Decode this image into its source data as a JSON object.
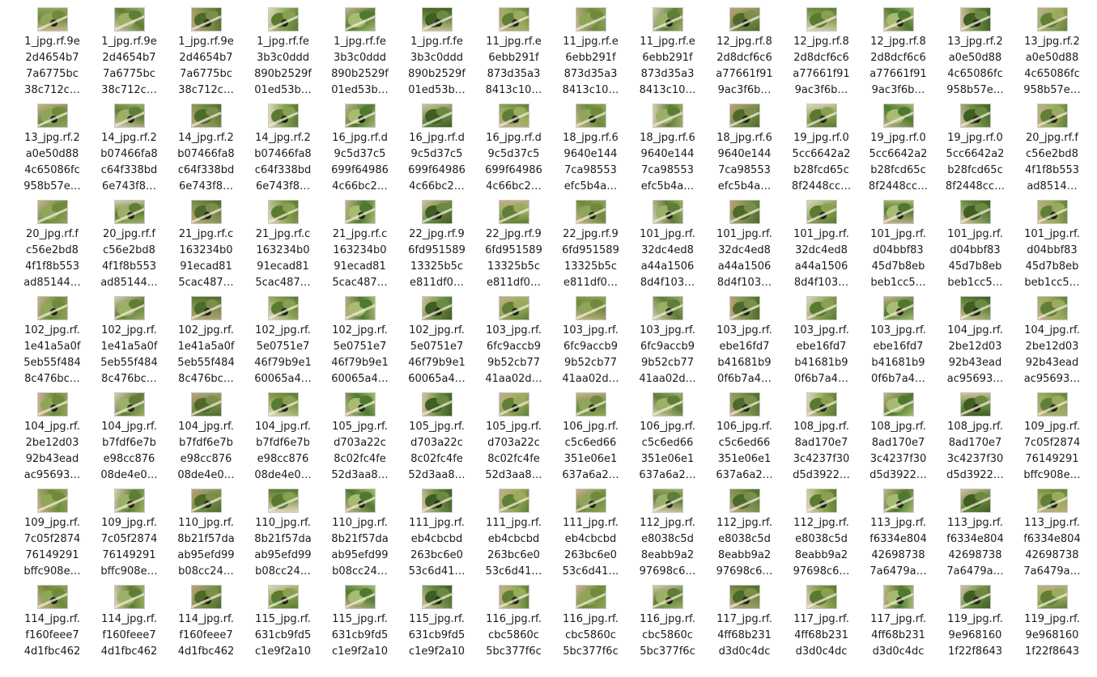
{
  "files": [
    {
      "l1": "1_jpg.rf.9e",
      "l2": "2d4654b7",
      "l3": "7a6775bc",
      "l4": "38c712c…",
      "icon": "image-thumbnail"
    },
    {
      "l1": "1_jpg.rf.9e",
      "l2": "2d4654b7",
      "l3": "7a6775bc",
      "l4": "38c712c…",
      "icon": "image-thumbnail"
    },
    {
      "l1": "1_jpg.rf.9e",
      "l2": "2d4654b7",
      "l3": "7a6775bc",
      "l4": "38c712c…",
      "icon": "image-thumbnail"
    },
    {
      "l1": "1_jpg.rf.fe",
      "l2": "3b3c0ddd",
      "l3": "890b2529f",
      "l4": "01ed53b…",
      "icon": "image-thumbnail"
    },
    {
      "l1": "1_jpg.rf.fe",
      "l2": "3b3c0ddd",
      "l3": "890b2529f",
      "l4": "01ed53b…",
      "icon": "image-thumbnail"
    },
    {
      "l1": "1_jpg.rf.fe",
      "l2": "3b3c0ddd",
      "l3": "890b2529f",
      "l4": "01ed53b…",
      "icon": "image-thumbnail"
    },
    {
      "l1": "11_jpg.rf.e",
      "l2": "6ebb291f",
      "l3": "873d35a3",
      "l4": "8413c10…",
      "icon": "image-thumbnail"
    },
    {
      "l1": "11_jpg.rf.e",
      "l2": "6ebb291f",
      "l3": "873d35a3",
      "l4": "8413c10…",
      "icon": "image-thumbnail"
    },
    {
      "l1": "11_jpg.rf.e",
      "l2": "6ebb291f",
      "l3": "873d35a3",
      "l4": "8413c10…",
      "icon": "image-thumbnail"
    },
    {
      "l1": "12_jpg.rf.8",
      "l2": "2d8dcf6c6",
      "l3": "a77661f91",
      "l4": "9ac3f6b…",
      "icon": "image-thumbnail"
    },
    {
      "l1": "12_jpg.rf.8",
      "l2": "2d8dcf6c6",
      "l3": "a77661f91",
      "l4": "9ac3f6b…",
      "icon": "image-thumbnail"
    },
    {
      "l1": "12_jpg.rf.8",
      "l2": "2d8dcf6c6",
      "l3": "a77661f91",
      "l4": "9ac3f6b…",
      "icon": "image-thumbnail"
    },
    {
      "l1": "13_jpg.rf.2",
      "l2": "a0e50d88",
      "l3": "4c65086fc",
      "l4": "958b57e…",
      "icon": "image-thumbnail"
    },
    {
      "l1": "13_jpg.rf.2",
      "l2": "a0e50d88",
      "l3": "4c65086fc",
      "l4": "958b57e…",
      "icon": "image-thumbnail"
    },
    {
      "l1": "13_jpg.rf.2",
      "l2": "a0e50d88",
      "l3": "4c65086fc",
      "l4": "958b57e…",
      "icon": "image-thumbnail"
    },
    {
      "l1": "14_jpg.rf.2",
      "l2": "b07466fa8",
      "l3": "c64f338bd",
      "l4": "6e743f8…",
      "icon": "image-thumbnail"
    },
    {
      "l1": "14_jpg.rf.2",
      "l2": "b07466fa8",
      "l3": "c64f338bd",
      "l4": "6e743f8…",
      "icon": "image-thumbnail"
    },
    {
      "l1": "14_jpg.rf.2",
      "l2": "b07466fa8",
      "l3": "c64f338bd",
      "l4": "6e743f8…",
      "icon": "image-thumbnail"
    },
    {
      "l1": "16_jpg.rf.d",
      "l2": "9c5d37c5",
      "l3": "699f64986",
      "l4": "4c66bc2…",
      "icon": "image-thumbnail"
    },
    {
      "l1": "16_jpg.rf.d",
      "l2": "9c5d37c5",
      "l3": "699f64986",
      "l4": "4c66bc2…",
      "icon": "image-thumbnail"
    },
    {
      "l1": "16_jpg.rf.d",
      "l2": "9c5d37c5",
      "l3": "699f64986",
      "l4": "4c66bc2…",
      "icon": "image-thumbnail"
    },
    {
      "l1": "18_jpg.rf.6",
      "l2": "9640e144",
      "l3": "7ca98553",
      "l4": "efc5b4a…",
      "icon": "image-thumbnail"
    },
    {
      "l1": "18_jpg.rf.6",
      "l2": "9640e144",
      "l3": "7ca98553",
      "l4": "efc5b4a…",
      "icon": "image-thumbnail"
    },
    {
      "l1": "18_jpg.rf.6",
      "l2": "9640e144",
      "l3": "7ca98553",
      "l4": "efc5b4a…",
      "icon": "image-thumbnail"
    },
    {
      "l1": "19_jpg.rf.0",
      "l2": "5cc6642a2",
      "l3": "b28fcd65c",
      "l4": "8f2448cc…",
      "icon": "image-thumbnail"
    },
    {
      "l1": "19_jpg.rf.0",
      "l2": "5cc6642a2",
      "l3": "b28fcd65c",
      "l4": "8f2448cc…",
      "icon": "image-thumbnail"
    },
    {
      "l1": "19_jpg.rf.0",
      "l2": "5cc6642a2",
      "l3": "b28fcd65c",
      "l4": "8f2448cc…",
      "icon": "image-thumbnail"
    },
    {
      "l1": "20_jpg.rf.f",
      "l2": "c56e2bd8",
      "l3": "4f1f8b553",
      "l4": "ad8514…",
      "icon": "image-thumbnail"
    },
    {
      "l1": "20_jpg.rf.f",
      "l2": "c56e2bd8",
      "l3": "4f1f8b553",
      "l4": "ad85144…",
      "icon": "image-thumbnail"
    },
    {
      "l1": "20_jpg.rf.f",
      "l2": "c56e2bd8",
      "l3": "4f1f8b553",
      "l4": "ad85144…",
      "icon": "image-thumbnail"
    },
    {
      "l1": "21_jpg.rf.c",
      "l2": "163234b0",
      "l3": "91ecad81",
      "l4": "5cac487…",
      "icon": "image-thumbnail"
    },
    {
      "l1": "21_jpg.rf.c",
      "l2": "163234b0",
      "l3": "91ecad81",
      "l4": "5cac487…",
      "icon": "image-thumbnail"
    },
    {
      "l1": "21_jpg.rf.c",
      "l2": "163234b0",
      "l3": "91ecad81",
      "l4": "5cac487…",
      "icon": "image-thumbnail"
    },
    {
      "l1": "22_jpg.rf.9",
      "l2": "6fd951589",
      "l3": "13325b5c",
      "l4": "e811df0…",
      "icon": "image-thumbnail"
    },
    {
      "l1": "22_jpg.rf.9",
      "l2": "6fd951589",
      "l3": "13325b5c",
      "l4": "e811df0…",
      "icon": "image-thumbnail"
    },
    {
      "l1": "22_jpg.rf.9",
      "l2": "6fd951589",
      "l3": "13325b5c",
      "l4": "e811df0…",
      "icon": "image-thumbnail"
    },
    {
      "l1": "101_jpg.rf.",
      "l2": "32dc4ed8",
      "l3": "a44a1506",
      "l4": "8d4f103…",
      "icon": "image-thumbnail"
    },
    {
      "l1": "101_jpg.rf.",
      "l2": "32dc4ed8",
      "l3": "a44a1506",
      "l4": "8d4f103…",
      "icon": "image-thumbnail"
    },
    {
      "l1": "101_jpg.rf.",
      "l2": "32dc4ed8",
      "l3": "a44a1506",
      "l4": "8d4f103…",
      "icon": "image-thumbnail"
    },
    {
      "l1": "101_jpg.rf.",
      "l2": "d04bbf83",
      "l3": "45d7b8eb",
      "l4": "beb1cc5…",
      "icon": "image-thumbnail"
    },
    {
      "l1": "101_jpg.rf.",
      "l2": "d04bbf83",
      "l3": "45d7b8eb",
      "l4": "beb1cc5…",
      "icon": "image-thumbnail"
    },
    {
      "l1": "101_jpg.rf.",
      "l2": "d04bbf83",
      "l3": "45d7b8eb",
      "l4": "beb1cc5…",
      "icon": "image-thumbnail"
    },
    {
      "l1": "102_jpg.rf.",
      "l2": "1e41a5a0f",
      "l3": "5eb55f484",
      "l4": "8c476bc…",
      "icon": "image-thumbnail"
    },
    {
      "l1": "102_jpg.rf.",
      "l2": "1e41a5a0f",
      "l3": "5eb55f484",
      "l4": "8c476bc…",
      "icon": "image-thumbnail"
    },
    {
      "l1": "102_jpg.rf.",
      "l2": "1e41a5a0f",
      "l3": "5eb55f484",
      "l4": "8c476bc…",
      "icon": "image-thumbnail"
    },
    {
      "l1": "102_jpg.rf.",
      "l2": "5e0751e7",
      "l3": "46f79b9e1",
      "l4": "60065a4…",
      "icon": "image-thumbnail"
    },
    {
      "l1": "102_jpg.rf.",
      "l2": "5e0751e7",
      "l3": "46f79b9e1",
      "l4": "60065a4…",
      "icon": "image-thumbnail"
    },
    {
      "l1": "102_jpg.rf.",
      "l2": "5e0751e7",
      "l3": "46f79b9e1",
      "l4": "60065a4…",
      "icon": "image-thumbnail"
    },
    {
      "l1": "103_jpg.rf.",
      "l2": "6fc9accb9",
      "l3": "9b52cb77",
      "l4": "41aa02d…",
      "icon": "image-thumbnail"
    },
    {
      "l1": "103_jpg.rf.",
      "l2": "6fc9accb9",
      "l3": "9b52cb77",
      "l4": "41aa02d…",
      "icon": "image-thumbnail"
    },
    {
      "l1": "103_jpg.rf.",
      "l2": "6fc9accb9",
      "l3": "9b52cb77",
      "l4": "41aa02d…",
      "icon": "image-thumbnail"
    },
    {
      "l1": "103_jpg.rf.",
      "l2": "ebe16fd7",
      "l3": "b41681b9",
      "l4": "0f6b7a4…",
      "icon": "image-thumbnail"
    },
    {
      "l1": "103_jpg.rf.",
      "l2": "ebe16fd7",
      "l3": "b41681b9",
      "l4": "0f6b7a4…",
      "icon": "image-thumbnail"
    },
    {
      "l1": "103_jpg.rf.",
      "l2": "ebe16fd7",
      "l3": "b41681b9",
      "l4": "0f6b7a4…",
      "icon": "image-thumbnail"
    },
    {
      "l1": "104_jpg.rf.",
      "l2": "2be12d03",
      "l3": "92b43ead",
      "l4": "ac95693…",
      "icon": "image-thumbnail"
    },
    {
      "l1": "104_jpg.rf.",
      "l2": "2be12d03",
      "l3": "92b43ead",
      "l4": "ac95693…",
      "icon": "image-thumbnail"
    },
    {
      "l1": "104_jpg.rf.",
      "l2": "2be12d03",
      "l3": "92b43ead",
      "l4": "ac95693…",
      "icon": "image-thumbnail"
    },
    {
      "l1": "104_jpg.rf.",
      "l2": "b7fdf6e7b",
      "l3": "e98cc876",
      "l4": "08de4e0…",
      "icon": "image-thumbnail"
    },
    {
      "l1": "104_jpg.rf.",
      "l2": "b7fdf6e7b",
      "l3": "e98cc876",
      "l4": "08de4e0…",
      "icon": "image-thumbnail"
    },
    {
      "l1": "104_jpg.rf.",
      "l2": "b7fdf6e7b",
      "l3": "e98cc876",
      "l4": "08de4e0…",
      "icon": "image-thumbnail"
    },
    {
      "l1": "105_jpg.rf.",
      "l2": "d703a22c",
      "l3": "8c02fc4fe",
      "l4": "52d3aa8…",
      "icon": "image-thumbnail"
    },
    {
      "l1": "105_jpg.rf.",
      "l2": "d703a22c",
      "l3": "8c02fc4fe",
      "l4": "52d3aa8…",
      "icon": "image-thumbnail"
    },
    {
      "l1": "105_jpg.rf.",
      "l2": "d703a22c",
      "l3": "8c02fc4fe",
      "l4": "52d3aa8…",
      "icon": "image-thumbnail"
    },
    {
      "l1": "106_jpg.rf.",
      "l2": "c5c6ed66",
      "l3": "351e06e1",
      "l4": "637a6a2…",
      "icon": "image-thumbnail"
    },
    {
      "l1": "106_jpg.rf.",
      "l2": "c5c6ed66",
      "l3": "351e06e1",
      "l4": "637a6a2…",
      "icon": "image-thumbnail"
    },
    {
      "l1": "106_jpg.rf.",
      "l2": "c5c6ed66",
      "l3": "351e06e1",
      "l4": "637a6a2…",
      "icon": "image-thumbnail"
    },
    {
      "l1": "108_jpg.rf.",
      "l2": "8ad170e7",
      "l3": "3c4237f30",
      "l4": "d5d3922…",
      "icon": "image-thumbnail"
    },
    {
      "l1": "108_jpg.rf.",
      "l2": "8ad170e7",
      "l3": "3c4237f30",
      "l4": "d5d3922…",
      "icon": "image-thumbnail"
    },
    {
      "l1": "108_jpg.rf.",
      "l2": "8ad170e7",
      "l3": "3c4237f30",
      "l4": "d5d3922…",
      "icon": "image-thumbnail"
    },
    {
      "l1": "109_jpg.rf.",
      "l2": "7c05f2874",
      "l3": "76149291",
      "l4": "bffc908e…",
      "icon": "image-thumbnail"
    },
    {
      "l1": "109_jpg.rf.",
      "l2": "7c05f2874",
      "l3": "76149291",
      "l4": "bffc908e…",
      "icon": "image-thumbnail"
    },
    {
      "l1": "109_jpg.rf.",
      "l2": "7c05f2874",
      "l3": "76149291",
      "l4": "bffc908e…",
      "icon": "image-thumbnail"
    },
    {
      "l1": "110_jpg.rf.",
      "l2": "8b21f57da",
      "l3": "ab95efd99",
      "l4": "b08cc24…",
      "icon": "image-thumbnail"
    },
    {
      "l1": "110_jpg.rf.",
      "l2": "8b21f57da",
      "l3": "ab95efd99",
      "l4": "b08cc24…",
      "icon": "image-thumbnail"
    },
    {
      "l1": "110_jpg.rf.",
      "l2": "8b21f57da",
      "l3": "ab95efd99",
      "l4": "b08cc24…",
      "icon": "image-thumbnail"
    },
    {
      "l1": "111_jpg.rf.",
      "l2": "eb4cbcbd",
      "l3": "263bc6e0",
      "l4": "53c6d41…",
      "icon": "image-thumbnail"
    },
    {
      "l1": "111_jpg.rf.",
      "l2": "eb4cbcbd",
      "l3": "263bc6e0",
      "l4": "53c6d41…",
      "icon": "image-thumbnail"
    },
    {
      "l1": "111_jpg.rf.",
      "l2": "eb4cbcbd",
      "l3": "263bc6e0",
      "l4": "53c6d41…",
      "icon": "image-thumbnail"
    },
    {
      "l1": "112_jpg.rf.",
      "l2": "e8038c5d",
      "l3": "8eabb9a2",
      "l4": "97698c6…",
      "icon": "image-thumbnail"
    },
    {
      "l1": "112_jpg.rf.",
      "l2": "e8038c5d",
      "l3": "8eabb9a2",
      "l4": "97698c6…",
      "icon": "image-thumbnail"
    },
    {
      "l1": "112_jpg.rf.",
      "l2": "e8038c5d",
      "l3": "8eabb9a2",
      "l4": "97698c6…",
      "icon": "image-thumbnail"
    },
    {
      "l1": "113_jpg.rf.",
      "l2": "f6334e804",
      "l3": "42698738",
      "l4": "7a6479a…",
      "icon": "image-thumbnail"
    },
    {
      "l1": "113_jpg.rf.",
      "l2": "f6334e804",
      "l3": "42698738",
      "l4": "7a6479a…",
      "icon": "image-thumbnail"
    },
    {
      "l1": "113_jpg.rf.",
      "l2": "f6334e804",
      "l3": "42698738",
      "l4": "7a6479a…",
      "icon": "image-thumbnail"
    },
    {
      "l1": "114_jpg.rf.",
      "l2": "f160feee7",
      "l3": "4d1fbc462",
      "l4": "",
      "icon": "image-thumbnail"
    },
    {
      "l1": "114_jpg.rf.",
      "l2": "f160feee7",
      "l3": "4d1fbc462",
      "l4": "",
      "icon": "image-thumbnail"
    },
    {
      "l1": "114_jpg.rf.",
      "l2": "f160feee7",
      "l3": "4d1fbc462",
      "l4": "",
      "icon": "image-thumbnail"
    },
    {
      "l1": "115_jpg.rf.",
      "l2": "631cb9fd5",
      "l3": "c1e9f2a10",
      "l4": "",
      "icon": "image-thumbnail"
    },
    {
      "l1": "115_jpg.rf.",
      "l2": "631cb9fd5",
      "l3": "c1e9f2a10",
      "l4": "",
      "icon": "image-thumbnail"
    },
    {
      "l1": "115_jpg.rf.",
      "l2": "631cb9fd5",
      "l3": "c1e9f2a10",
      "l4": "",
      "icon": "image-thumbnail"
    },
    {
      "l1": "116_jpg.rf.",
      "l2": "cbc5860c",
      "l3": "5bc377f6c",
      "l4": "",
      "icon": "image-thumbnail"
    },
    {
      "l1": "116_jpg.rf.",
      "l2": "cbc5860c",
      "l3": "5bc377f6c",
      "l4": "",
      "icon": "image-thumbnail"
    },
    {
      "l1": "116_jpg.rf.",
      "l2": "cbc5860c",
      "l3": "5bc377f6c",
      "l4": "",
      "icon": "image-thumbnail"
    },
    {
      "l1": "117_jpg.rf.",
      "l2": "4ff68b231",
      "l3": "d3d0c4dc",
      "l4": "",
      "icon": "image-thumbnail"
    },
    {
      "l1": "117_jpg.rf.",
      "l2": "4ff68b231",
      "l3": "d3d0c4dc",
      "l4": "",
      "icon": "image-thumbnail"
    },
    {
      "l1": "117_jpg.rf.",
      "l2": "4ff68b231",
      "l3": "d3d0c4dc",
      "l4": "",
      "icon": "image-thumbnail"
    },
    {
      "l1": "119_jpg.rf.",
      "l2": "9e968160",
      "l3": "1f22f8643",
      "l4": "",
      "icon": "image-thumbnail"
    },
    {
      "l1": "119_jpg.rf.",
      "l2": "9e968160",
      "l3": "1f22f8643",
      "l4": "",
      "icon": "image-thumbnail"
    }
  ]
}
